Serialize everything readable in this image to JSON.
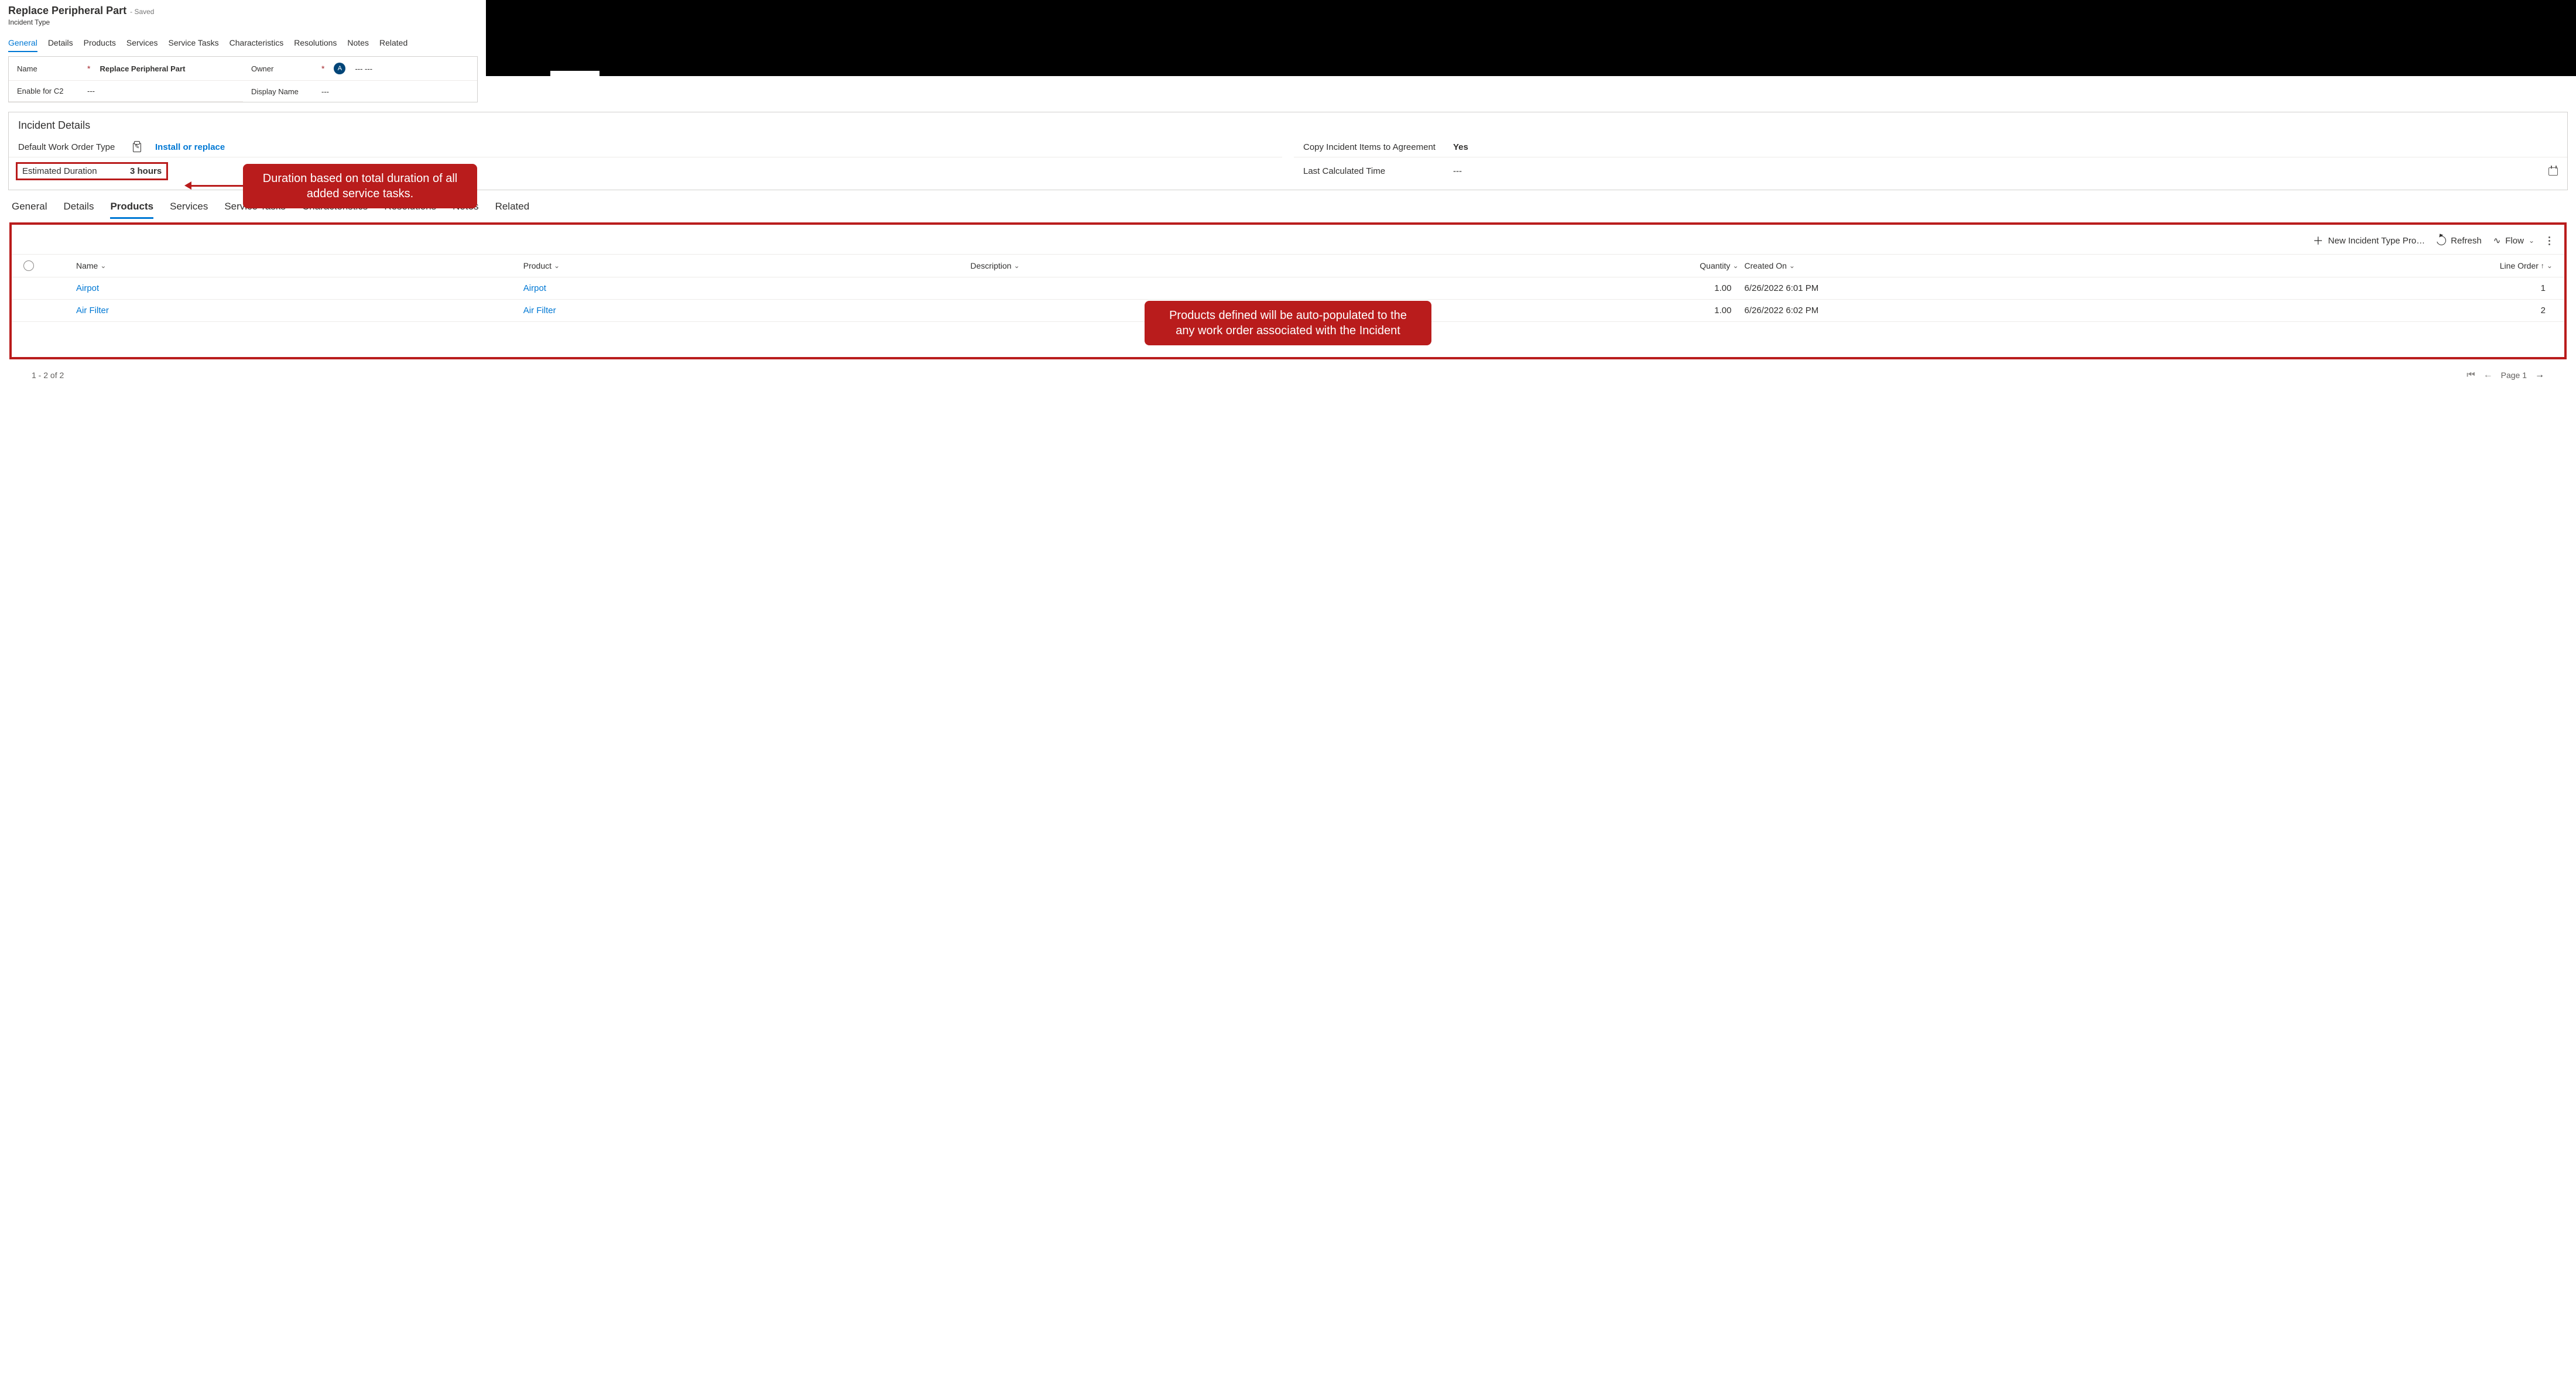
{
  "header": {
    "title": "Replace Peripheral Part",
    "saved_suffix": "- Saved",
    "subtitle": "Incident Type"
  },
  "tabs_top": {
    "items": [
      "General",
      "Details",
      "Products",
      "Services",
      "Service Tasks",
      "Characteristics",
      "Resolutions",
      "Notes",
      "Related"
    ],
    "active_index": 0
  },
  "form": {
    "name_label": "Name",
    "name_value": "Replace Peripheral Part",
    "owner_label": "Owner",
    "owner_value": "--- ---",
    "enable_c2_label": "Enable for C2",
    "enable_c2_value": "---",
    "display_name_label": "Display Name",
    "display_name_value": "---"
  },
  "incident_details": {
    "section_title": "Incident Details",
    "wo_type_label": "Default Work Order Type",
    "wo_type_value": "Install or replace",
    "copy_label": "Copy Incident Items to Agreement",
    "copy_value": "Yes",
    "est_dur_label": "Estimated Duration",
    "est_dur_value": "3 hours",
    "calc_time_label": "Last Calculated Time",
    "calc_time_value": "---"
  },
  "callouts": {
    "duration": "Duration based on total duration of all added service tasks.",
    "products": "Products defined will be auto-populated to the any work order associated with the Incident"
  },
  "tabs_lower": {
    "items": [
      "General",
      "Details",
      "Products",
      "Services",
      "Service Tasks",
      "Characteristics",
      "Resolutions",
      "Notes",
      "Related"
    ],
    "active_index": 2
  },
  "grid_toolbar": {
    "new_label": "New Incident Type Pro…",
    "refresh_label": "Refresh",
    "flow_label": "Flow"
  },
  "grid": {
    "columns": {
      "name": "Name",
      "product": "Product",
      "description": "Description",
      "quantity": "Quantity",
      "created_on": "Created On",
      "line_order": "Line Order"
    },
    "rows": [
      {
        "name": "Airpot",
        "product": "Airpot",
        "description": "",
        "quantity": "1.00",
        "created_on": "6/26/2022 6:01 PM",
        "line_order": "1"
      },
      {
        "name": "Air Filter",
        "product": "Air Filter",
        "description": "",
        "quantity": "1.00",
        "created_on": "6/26/2022 6:02 PM",
        "line_order": "2"
      }
    ]
  },
  "pager": {
    "summary": "1 - 2 of 2",
    "page_label": "Page 1"
  }
}
